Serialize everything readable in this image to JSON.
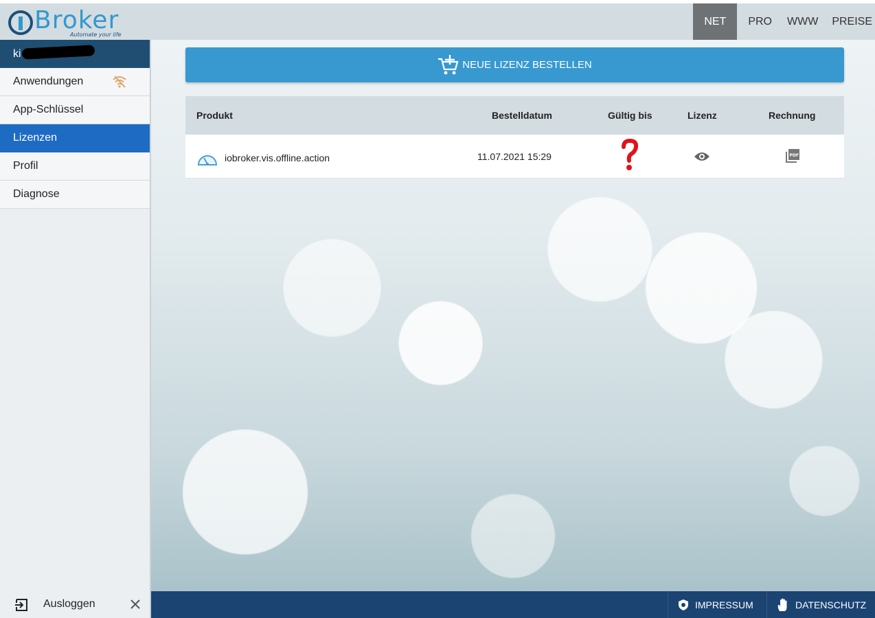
{
  "header": {
    "logo_text": "Broker",
    "logo_tagline": "Automate your life",
    "nav": [
      "NET",
      "PRO",
      "WWW",
      "PREISE"
    ],
    "active_nav": "NET"
  },
  "sidebar": {
    "user_name_visible": "ki",
    "items": [
      {
        "label": "Anwendungen",
        "icon": "wifi-off-icon"
      },
      {
        "label": "App-Schlüssel"
      },
      {
        "label": "Lizenzen",
        "active": true
      },
      {
        "label": "Profil"
      },
      {
        "label": "Diagnose"
      }
    ],
    "logout_label": "Ausloggen"
  },
  "main": {
    "order_button": "NEUE LIZENZ BESTELLEN",
    "table": {
      "columns": [
        "Produkt",
        "Bestelldatum",
        "Gültig bis",
        "Lizenz",
        "Rechnung"
      ],
      "rows": [
        {
          "product": "iobroker.vis.offline.action",
          "order_date": "11.07.2021 15:29",
          "valid_until_icon": "question-mark-icon",
          "license_icon": "eye-icon",
          "invoice_icon": "pdf-icon"
        }
      ]
    }
  },
  "footer": {
    "impressum": "IMPRESSUM",
    "datenschutz": "DATENSCHUTZ"
  },
  "colors": {
    "accent": "#3799cf",
    "sidebar_active": "#1e6bc4",
    "footer": "#1b4473",
    "question_mark": "#e0131a"
  }
}
